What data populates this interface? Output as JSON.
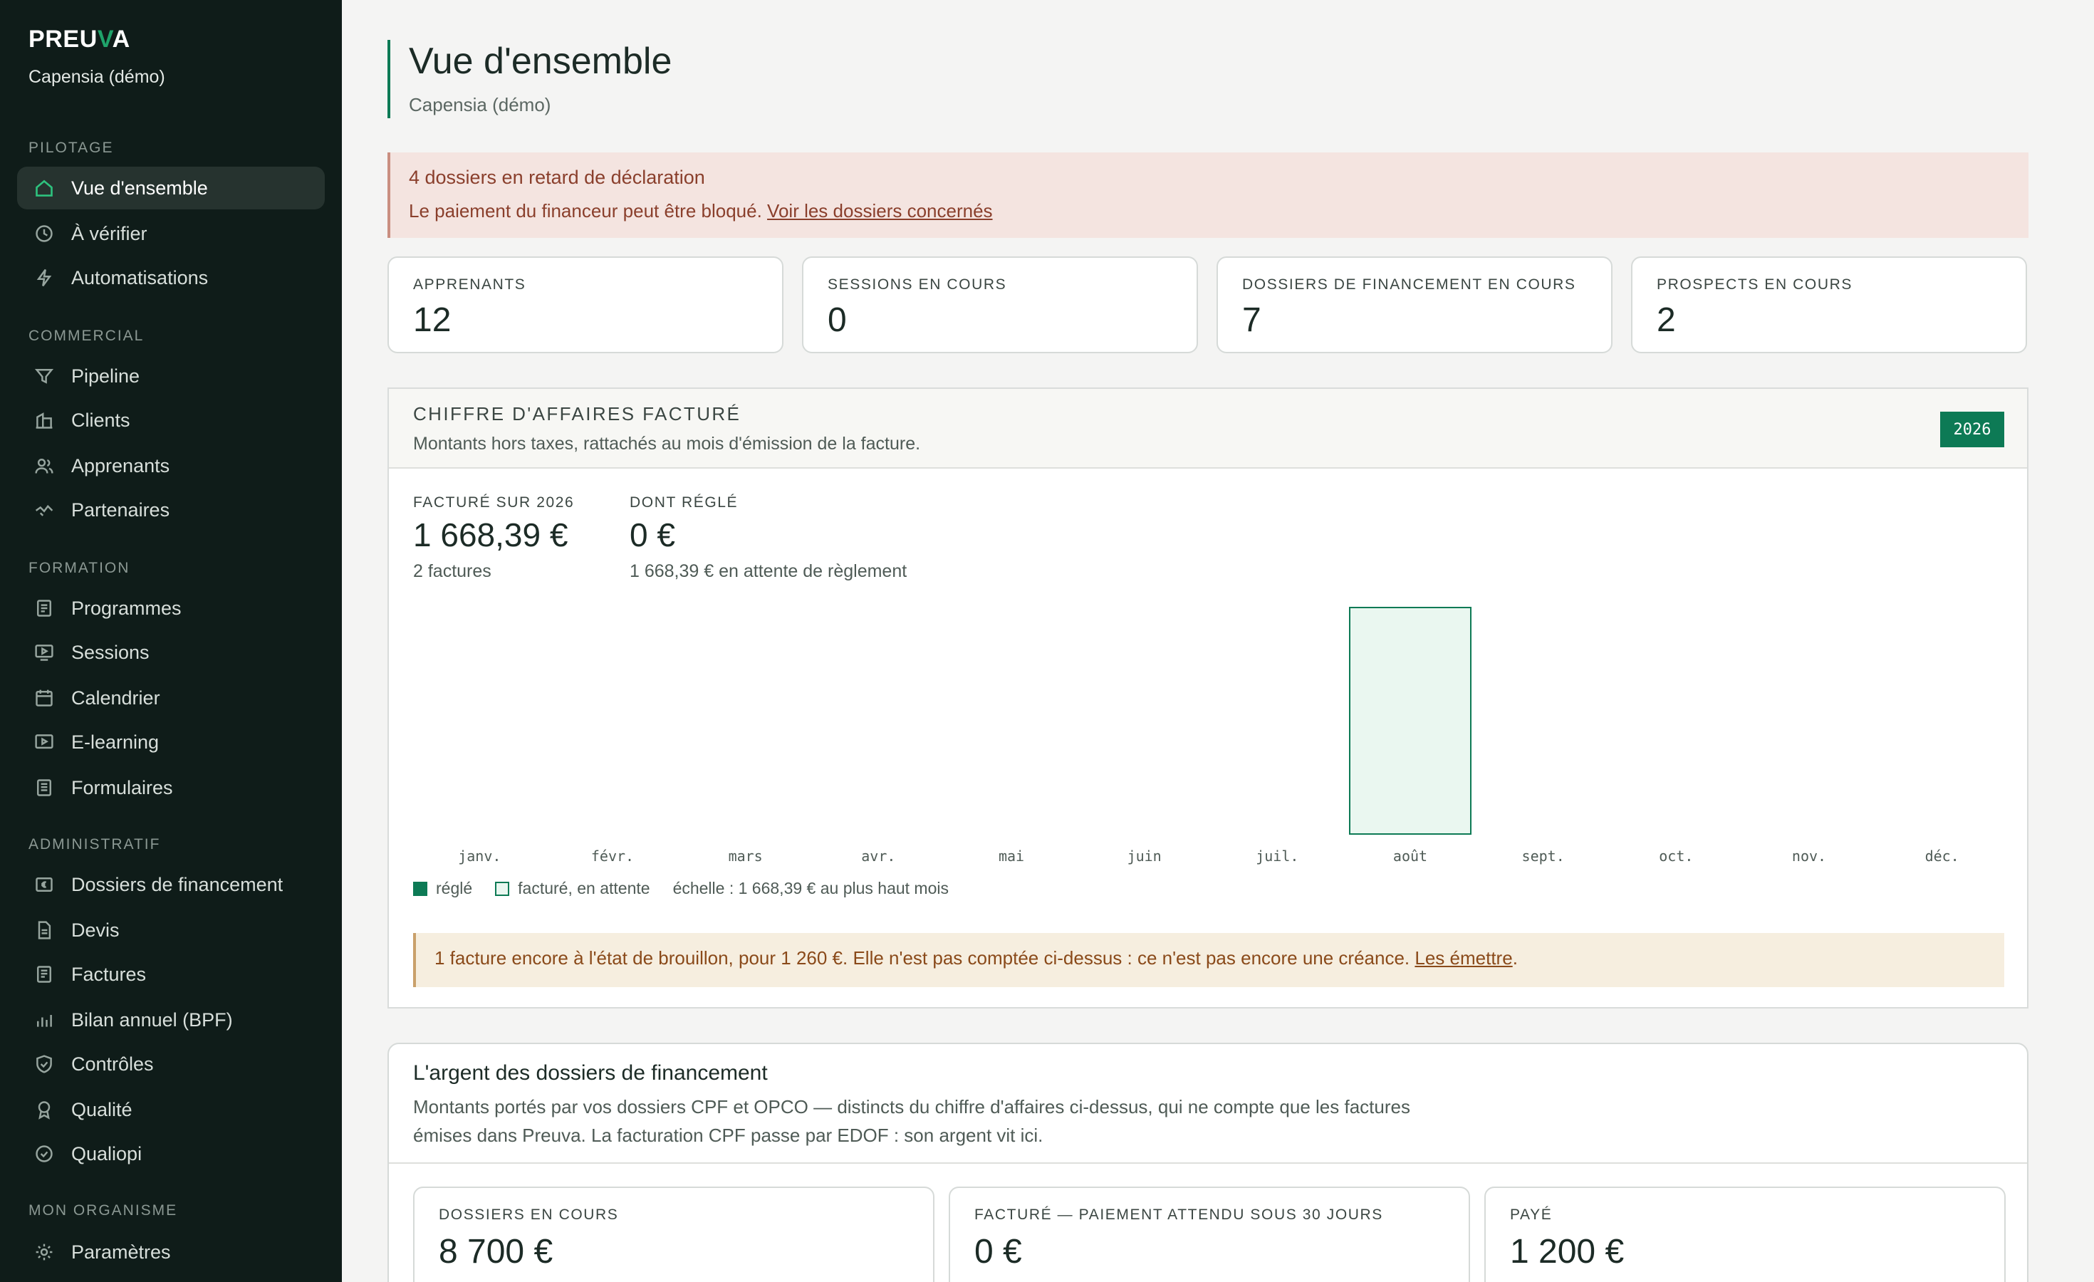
{
  "brand": {
    "prefix": "PREU",
    "accent_letter": "V",
    "suffix": "A"
  },
  "organization": "Capensia (démo)",
  "sidebar": {
    "sections": [
      {
        "label": "PILOTAGE",
        "items": [
          {
            "label": "Vue d'ensemble",
            "icon": "home-icon",
            "active": true
          },
          {
            "label": "À vérifier",
            "icon": "clock-icon"
          },
          {
            "label": "Automatisations",
            "icon": "bolt-icon"
          }
        ]
      },
      {
        "label": "COMMERCIAL",
        "items": [
          {
            "label": "Pipeline",
            "icon": "filter-icon"
          },
          {
            "label": "Clients",
            "icon": "building-icon"
          },
          {
            "label": "Apprenants",
            "icon": "users-icon"
          },
          {
            "label": "Partenaires",
            "icon": "handshake-icon"
          }
        ]
      },
      {
        "label": "FORMATION",
        "items": [
          {
            "label": "Programmes",
            "icon": "document-icon"
          },
          {
            "label": "Sessions",
            "icon": "presentation-icon"
          },
          {
            "label": "Calendrier",
            "icon": "calendar-icon"
          },
          {
            "label": "E-learning",
            "icon": "video-icon"
          },
          {
            "label": "Formulaires",
            "icon": "form-icon"
          }
        ]
      },
      {
        "label": "ADMINISTRATIF",
        "items": [
          {
            "label": "Dossiers de financement",
            "icon": "euro-folder-icon"
          },
          {
            "label": "Devis",
            "icon": "quote-icon"
          },
          {
            "label": "Factures",
            "icon": "invoice-icon"
          },
          {
            "label": "Bilan annuel (BPF)",
            "icon": "bar-chart-icon"
          },
          {
            "label": "Contrôles",
            "icon": "shield-check-icon"
          },
          {
            "label": "Qualité",
            "icon": "award-icon"
          },
          {
            "label": "Qualiopi",
            "icon": "check-circle-icon"
          }
        ]
      },
      {
        "label": "MON ORGANISME",
        "items": [
          {
            "label": "Paramètres",
            "icon": "gear-icon"
          }
        ]
      }
    ]
  },
  "header": {
    "title": "Vue d'ensemble",
    "subtitle": "Capensia (démo)"
  },
  "alert": {
    "title": "4 dossiers en retard de déclaration",
    "text": "Le paiement du financeur peut être bloqué.",
    "link": "Voir les dossiers concernés"
  },
  "stats": [
    {
      "label": "APPRENANTS",
      "value": "12"
    },
    {
      "label": "SESSIONS EN COURS",
      "value": "0"
    },
    {
      "label": "DOSSIERS DE FINANCEMENT EN COURS",
      "value": "7"
    },
    {
      "label": "PROSPECTS EN COURS",
      "value": "2"
    }
  ],
  "revenue": {
    "title": "CHIFFRE D'AFFAIRES FACTURÉ",
    "subtitle": "Montants hors taxes, rattachés au mois d'émission de la facture.",
    "year": "2026",
    "invoiced": {
      "label": "FACTURÉ SUR 2026",
      "value": "1 668,39 €",
      "note": "2 factures"
    },
    "paid": {
      "label": "DONT RÉGLÉ",
      "value": "0 €",
      "note": "1 668,39 € en attente de règlement"
    },
    "legend": {
      "paid": "réglé",
      "pending": "facturé, en attente",
      "scale": "échelle : 1 668,39 € au plus haut mois"
    },
    "draft_note": {
      "text": "1 facture encore à l'état de brouillon, pour 1 260 €. Elle n'est pas comptée ci-dessus : ce n'est pas encore une créance.",
      "link": "Les émettre",
      "suffix": "."
    }
  },
  "chart_data": {
    "type": "bar",
    "categories": [
      "janv.",
      "févr.",
      "mars",
      "avr.",
      "mai",
      "juin",
      "juil.",
      "août",
      "sept.",
      "oct.",
      "nov.",
      "déc."
    ],
    "series": [
      {
        "name": "réglé",
        "values": [
          0,
          0,
          0,
          0,
          0,
          0,
          0,
          0,
          0,
          0,
          0,
          0
        ]
      },
      {
        "name": "facturé, en attente",
        "values": [
          0,
          0,
          0,
          0,
          0,
          0,
          0,
          1668.39,
          0,
          0,
          0,
          0
        ]
      }
    ],
    "ylim": [
      0,
      1668.39
    ],
    "colors": {
      "paid": "#0d7a55",
      "pending_fill": "#eaf7f0",
      "pending_stroke": "#0d7a55"
    }
  },
  "funding": {
    "title": "L'argent des dossiers de financement",
    "description": "Montants portés par vos dossiers CPF et OPCO — distincts du chiffre d'affaires ci-dessus, qui ne compte que les factures émises dans Preuva. La facturation CPF passe par EDOF : son argent vit ici.",
    "cards": [
      {
        "label": "DOSSIERS EN COURS",
        "value": "8 700 €"
      },
      {
        "label": "FACTURÉ — PAIEMENT ATTENDU SOUS 30 JOURS",
        "value": "0 €"
      },
      {
        "label": "PAYÉ",
        "value": "1 200 €"
      }
    ]
  }
}
